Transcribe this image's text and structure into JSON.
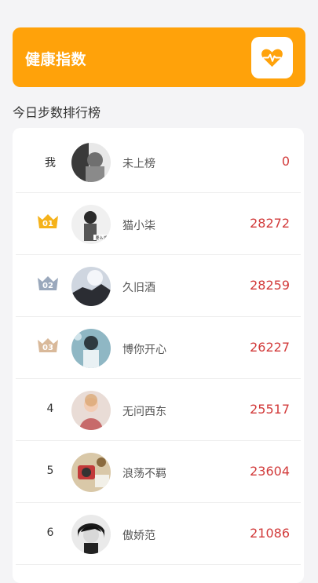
{
  "banner": {
    "title": "健康指数",
    "icon": "heart-pulse-icon",
    "accent": "#ffa20a"
  },
  "section_title": "今日步数排行榜",
  "ranking": [
    {
      "rank": "我",
      "name": "未上榜",
      "steps": "0",
      "badge": null
    },
    {
      "rank": "01",
      "name": "猫小柒",
      "steps": "28272",
      "badge": "gold"
    },
    {
      "rank": "02",
      "name": "久旧酒",
      "steps": "28259",
      "badge": "silver"
    },
    {
      "rank": "03",
      "name": "博你开心",
      "steps": "26227",
      "badge": "bronze"
    },
    {
      "rank": "4",
      "name": "无问西东",
      "steps": "25517",
      "badge": null
    },
    {
      "rank": "5",
      "name": "浪荡不羁",
      "steps": "23604",
      "badge": null
    },
    {
      "rank": "6",
      "name": "傲娇范",
      "steps": "21086",
      "badge": null
    }
  ],
  "colors": {
    "steps": "#d23a3a",
    "gold": "#f5b21a",
    "silver": "#9aa8bc",
    "bronze": "#d9b99a"
  }
}
